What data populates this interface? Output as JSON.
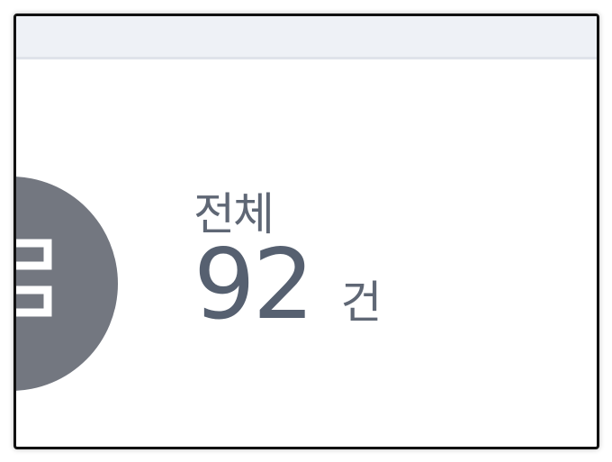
{
  "summary": {
    "label": "전체",
    "count": "92",
    "unit": "건",
    "icon": "list-icon"
  },
  "colors": {
    "top_strip": "#eef1f6",
    "icon_circle": "#737780",
    "text": "#5f6775"
  }
}
